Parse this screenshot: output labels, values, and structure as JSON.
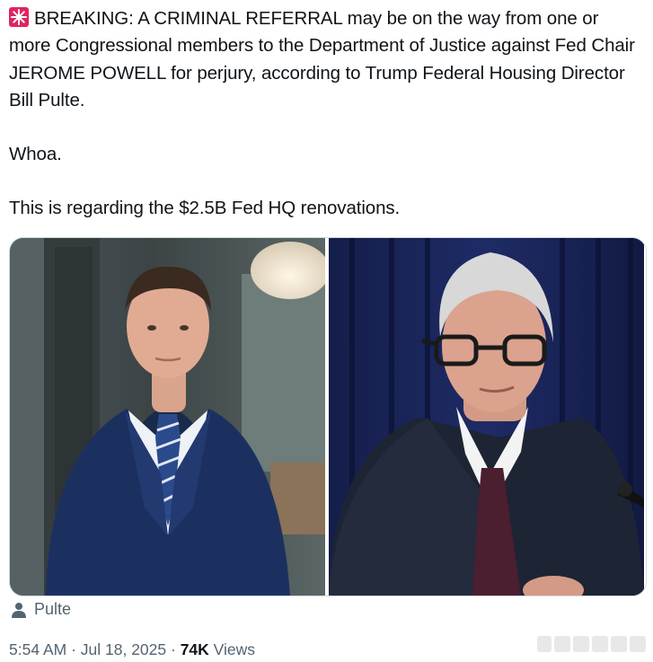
{
  "tweet": {
    "emoji": "🚨",
    "para1": "BREAKING: A CRIMINAL REFERRAL may be on the way from one or more Congressional members to the Department of Justice against Fed Chair JEROME POWELL for perjury, according to Trump Federal Housing Director Bill Pulte.",
    "para2": "Whoa.",
    "para3": "This is regarding the $2.5B Fed HQ renovations."
  },
  "media": {
    "tag_label": "Pulte"
  },
  "meta": {
    "time": "5:54 AM",
    "sep1": " · ",
    "date": "Jul 18, 2025",
    "sep2": " · ",
    "views_count": "74K",
    "views_label": " Views"
  },
  "colors": {
    "text": "#0f1419",
    "secondary": "#536471",
    "border": "#cfd9de",
    "siren": "#e0245e"
  }
}
